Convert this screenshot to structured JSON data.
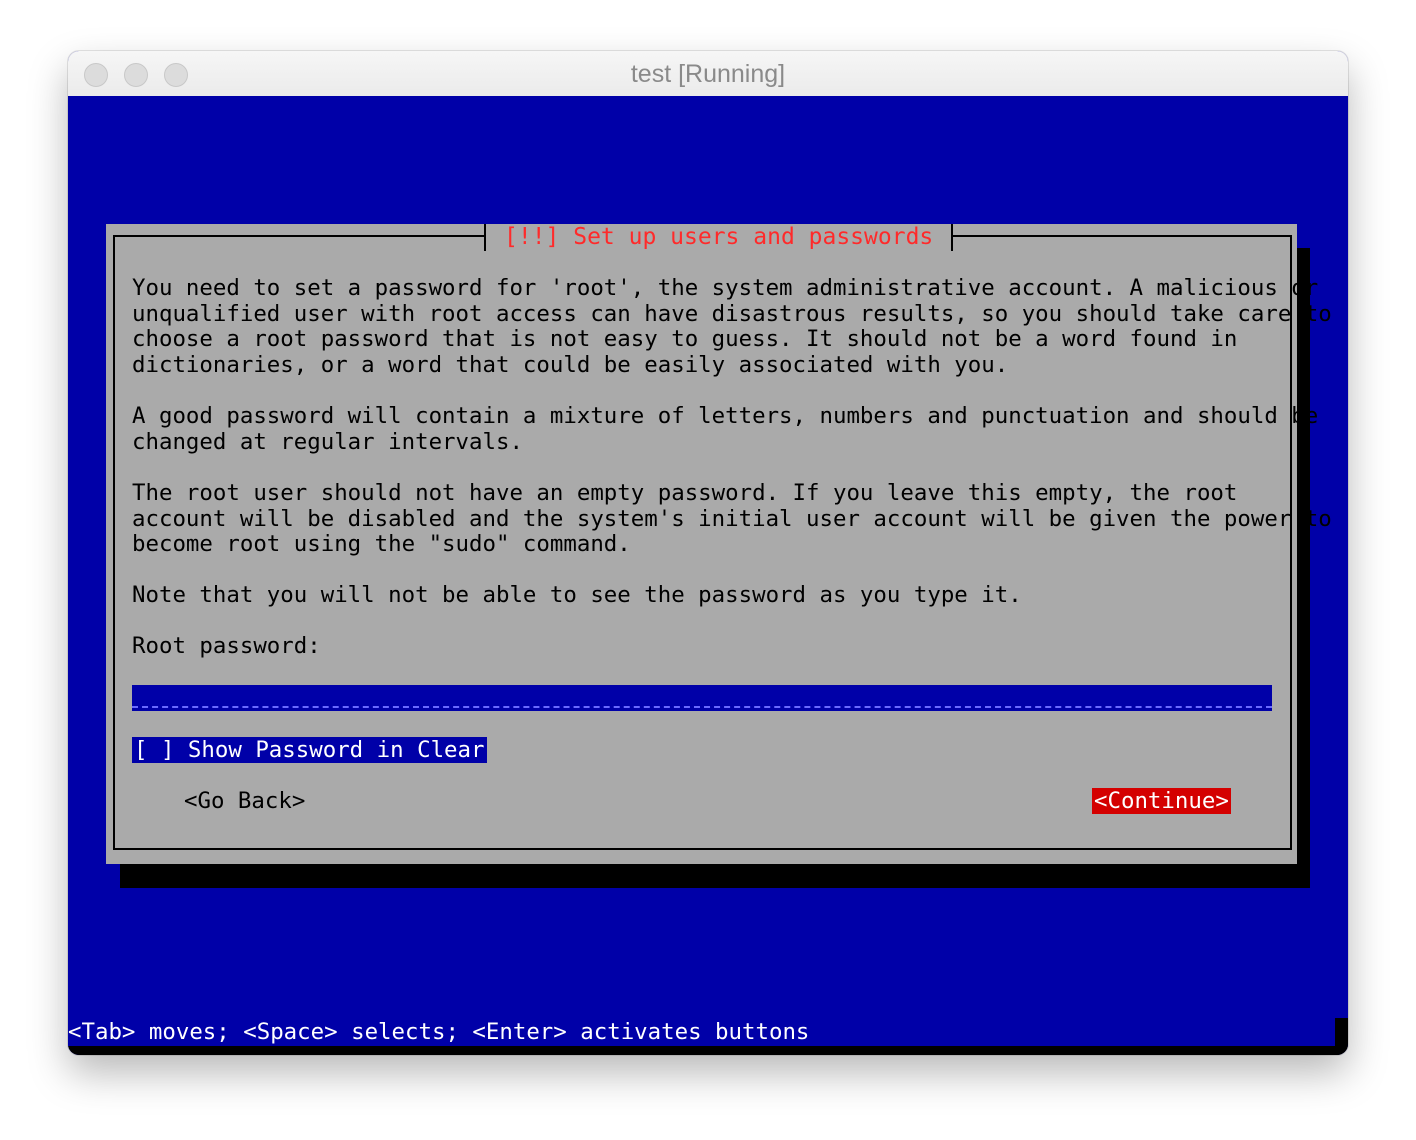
{
  "window": {
    "title": "test [Running]"
  },
  "dialog": {
    "title": "[!!] Set up users and passwords",
    "paragraphs": [
      "You need to set a password for 'root', the system administrative account. A malicious or",
      "unqualified user with root access can have disastrous results, so you should take care to",
      "choose a root password that is not easy to guess. It should not be a word found in",
      "dictionaries, or a word that could be easily associated with you.",
      "A good password will contain a mixture of letters, numbers and punctuation and should be",
      "changed at regular intervals.",
      "The root user should not have an empty password. If you leave this empty, the root",
      "account will be disabled and the system's initial user account will be given the power to",
      "become root using the \"sudo\" command.",
      "Note that you will not be able to see the password as you type it."
    ],
    "password_label": "Root password:",
    "password_value": "*****",
    "show_password_checkbox": "[ ] Show Password in Clear",
    "go_back_button": "<Go Back>",
    "continue_button": "<Continue>"
  },
  "statusbar": {
    "hint": "<Tab> moves; <Space> selects; <Enter> activates buttons"
  },
  "colors": {
    "screen_background": "#0000a8",
    "dialog_background": "#aaaaaa",
    "title_text": "#ff2a2a",
    "continue_highlight": "#d40000"
  }
}
